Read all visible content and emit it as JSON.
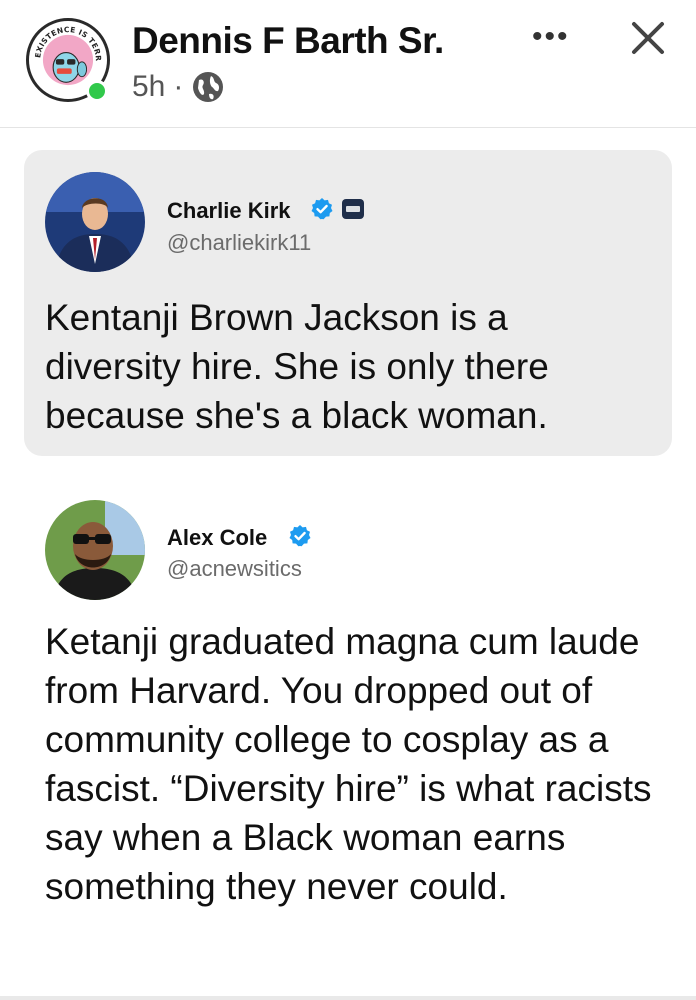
{
  "post": {
    "author": "Dennis F Barth Sr.",
    "time": "5h",
    "separator": "·",
    "more_label": "•••",
    "avatar_ring_text": "EXISTENCE IS TERRIFYING"
  },
  "quote": {
    "name": "Charlie Kirk",
    "handle": "@charliekirk11",
    "text": "Kentanji Brown Jackson is a diversity hire. She is only there because she's a black woman."
  },
  "reply": {
    "name": "Alex Cole",
    "handle": "@acnewsitics",
    "text": "Ketanji graduated magna cum laude from Harvard. You dropped out of community college to cosplay as a fascist. “Diversity hire” is what racists say when a Black woman earns something they never could."
  },
  "colors": {
    "verified": "#1d9bf0",
    "online": "#31c94b",
    "card_bg": "#ececec"
  },
  "icons": [
    "globe-icon",
    "close-icon",
    "verified-icon",
    "organization-badge-icon"
  ]
}
